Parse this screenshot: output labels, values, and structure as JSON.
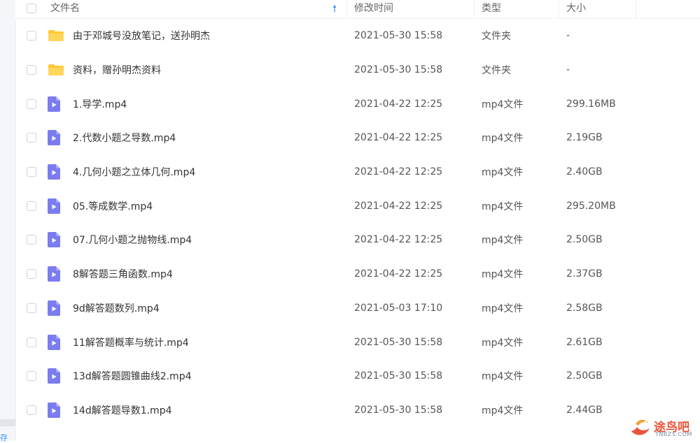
{
  "header": {
    "name": "文件名",
    "modified": "修改时间",
    "type": "类型",
    "size": "大小"
  },
  "rows": [
    {
      "kind": "folder",
      "name": "由于邓城号没放笔记，送孙明杰",
      "modified": "2021-05-30 15:58",
      "type": "文件夹",
      "size": "-"
    },
    {
      "kind": "folder",
      "name": "资料，赠孙明杰资料",
      "modified": "2021-05-30 15:58",
      "type": "文件夹",
      "size": "-"
    },
    {
      "kind": "video",
      "name": "1.导学.mp4",
      "modified": "2021-04-22 12:25",
      "type": "mp4文件",
      "size": "299.16MB"
    },
    {
      "kind": "video",
      "name": "2.代数小题之导数.mp4",
      "modified": "2021-04-22 12:25",
      "type": "mp4文件",
      "size": "2.19GB"
    },
    {
      "kind": "video",
      "name": "4.几何小题之立体几何.mp4",
      "modified": "2021-04-22 12:25",
      "type": "mp4文件",
      "size": "2.40GB"
    },
    {
      "kind": "video",
      "name": "05.等成数学.mp4",
      "modified": "2021-04-22 12:25",
      "type": "mp4文件",
      "size": "295.20MB"
    },
    {
      "kind": "video",
      "name": "07.几何小题之抛物线.mp4",
      "modified": "2021-04-22 12:25",
      "type": "mp4文件",
      "size": "2.50GB"
    },
    {
      "kind": "video",
      "name": "8解答题三角函数.mp4",
      "modified": "2021-04-22 12:25",
      "type": "mp4文件",
      "size": "2.37GB"
    },
    {
      "kind": "video",
      "name": "9d解答题数列.mp4",
      "modified": "2021-05-03 17:10",
      "type": "mp4文件",
      "size": "2.58GB"
    },
    {
      "kind": "video",
      "name": "11解答题概率与统计.mp4",
      "modified": "2021-05-30 15:58",
      "type": "mp4文件",
      "size": "2.61GB"
    },
    {
      "kind": "video",
      "name": "13d解答题圆锥曲线2.mp4",
      "modified": "2021-05-30 15:58",
      "type": "mp4文件",
      "size": "2.50GB"
    },
    {
      "kind": "video",
      "name": "14d解答题导数1.mp4",
      "modified": "2021-05-30 15:58",
      "type": "mp4文件",
      "size": "2.44GB"
    }
  ],
  "watermark": {
    "brand": "途鸟吧",
    "domain": "TNBZS.COM"
  },
  "rail": {
    "text": "存"
  },
  "colors": {
    "accent": "#2f86f6",
    "folder": "#ffc937",
    "video": "#7b7cf0"
  }
}
